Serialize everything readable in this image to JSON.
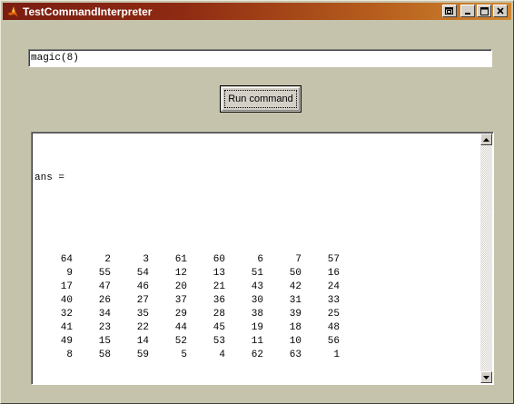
{
  "window": {
    "title": "TestCommandInterpreter"
  },
  "command": {
    "value": "magic(8)"
  },
  "run_button": {
    "label": "Run command"
  },
  "output": {
    "header": "ans =",
    "matrix": [
      [
        "64",
        "2",
        "3",
        "61",
        "60",
        "6",
        "7",
        "57"
      ],
      [
        "9",
        "55",
        "54",
        "12",
        "13",
        "51",
        "50",
        "16"
      ],
      [
        "17",
        "47",
        "46",
        "20",
        "21",
        "43",
        "42",
        "24"
      ],
      [
        "40",
        "26",
        "27",
        "37",
        "36",
        "30",
        "31",
        "33"
      ],
      [
        "32",
        "34",
        "35",
        "29",
        "28",
        "38",
        "39",
        "25"
      ],
      [
        "41",
        "23",
        "22",
        "44",
        "45",
        "19",
        "18",
        "48"
      ],
      [
        "49",
        "15",
        "14",
        "52",
        "53",
        "11",
        "10",
        "56"
      ],
      [
        "8",
        "58",
        "59",
        "5",
        "4",
        "62",
        "63",
        "1"
      ]
    ]
  },
  "icons": {
    "app": "matlab-logo-icon",
    "restore": "restore-icon",
    "minimize": "minimize-icon",
    "maximize": "maximize-icon",
    "close": "close-icon",
    "scroll_up": "scroll-up-arrow-icon",
    "scroll_down": "scroll-down-arrow-icon"
  },
  "colors": {
    "titlebar_start": "#7a1e12",
    "titlebar_end": "#d08830",
    "window_bg": "#c6c3ac"
  }
}
